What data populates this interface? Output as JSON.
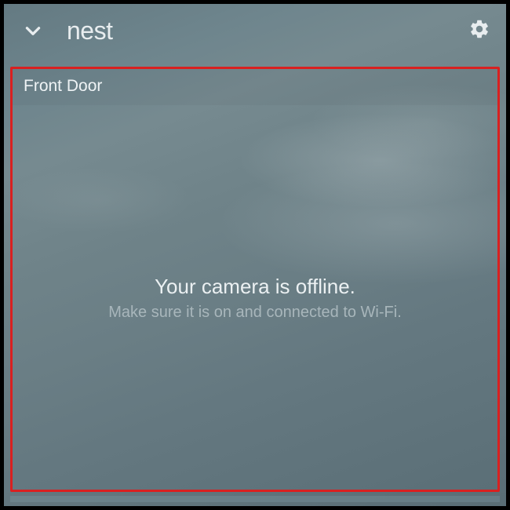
{
  "header": {
    "brand": "nest"
  },
  "camera": {
    "name": "Front Door",
    "status_title": "Your camera is offline.",
    "status_subtitle": "Make sure it is on and connected to Wi-Fi."
  },
  "colors": {
    "highlight_border": "#d92020"
  }
}
